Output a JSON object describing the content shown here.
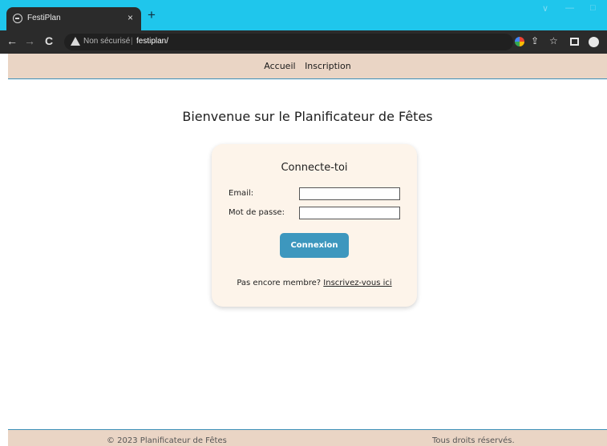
{
  "browser": {
    "tab_title": "FestiPlan",
    "tab_close": "×",
    "new_tab": "+",
    "insecure_label": "Non sécurisé",
    "separator": "|",
    "url": "festiplan/",
    "controls": {
      "back": "←",
      "forward": "→",
      "reload": "C",
      "minimize": "—",
      "maximize": "□",
      "chevron": "∨",
      "share": "⇪",
      "star": "☆"
    }
  },
  "nav": {
    "home": "Accueil",
    "signup": "Inscription"
  },
  "page": {
    "title": "Bienvenue sur le Planificateur de Fêtes"
  },
  "login": {
    "heading": "Connecte-toi",
    "email_label": "Email:",
    "email_value": "",
    "password_label": "Mot de passe:",
    "password_value": "",
    "submit_label": "Connexion",
    "signup_prompt": "Pas encore membre?",
    "signup_link": "Inscrivez-vous ici"
  },
  "footer": {
    "copyright": "© 2023 Planificateur de Fêtes",
    "rights": "Tous droits réservés."
  },
  "colors": {
    "tabstrip": "#1fc6ec",
    "nav_background": "#ead5c5",
    "accent": "#3d97be",
    "card_background": "#fdf4ea"
  }
}
